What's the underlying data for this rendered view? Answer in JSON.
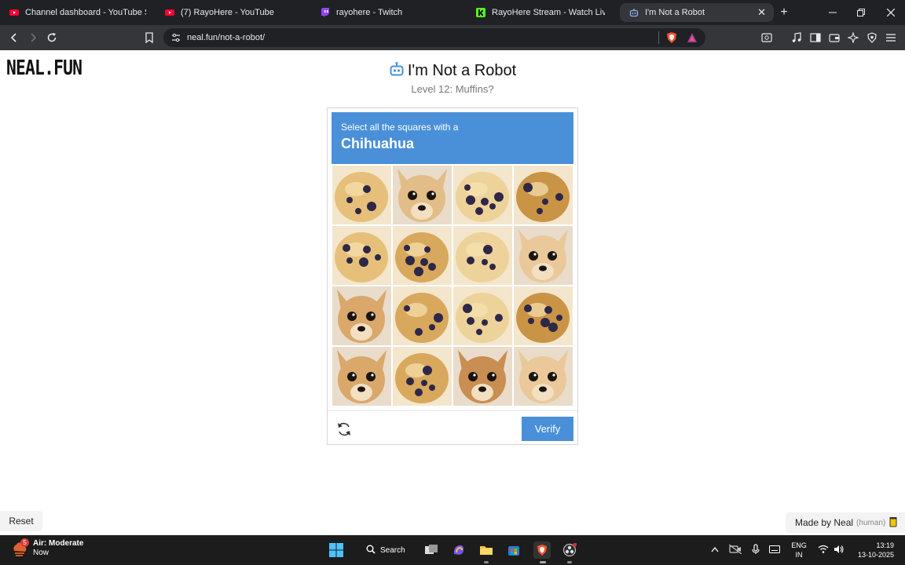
{
  "browser": {
    "tabs": [
      {
        "label": "Channel dashboard - YouTube Studio",
        "icon": "youtube-studio-icon"
      },
      {
        "label": "(7) RayoHere - YouTube",
        "icon": "youtube-icon"
      },
      {
        "label": "rayohere - Twitch",
        "icon": "twitch-icon"
      },
      {
        "label": "RayoHere Stream - Watch Live on Kick",
        "icon": "kick-icon"
      },
      {
        "label": "I'm Not a Robot",
        "icon": "robot-icon",
        "active": true
      }
    ],
    "url": "neal.fun/not-a-robot/"
  },
  "page": {
    "logo": "NEAL.FUN",
    "title": "I'm Not a Robot",
    "subtitle": "Level 12: Muffins?",
    "reset_label": "Reset",
    "made_by": "Made by Neal",
    "made_by_note": "(human)"
  },
  "captcha": {
    "instruction": "Select all the squares with a",
    "target": "Chihuahua",
    "verify_label": "Verify",
    "tiles": [
      {
        "content": "muffin"
      },
      {
        "content": "chihuahua"
      },
      {
        "content": "muffin"
      },
      {
        "content": "muffin"
      },
      {
        "content": "muffin"
      },
      {
        "content": "muffin"
      },
      {
        "content": "muffin"
      },
      {
        "content": "chihuahua"
      },
      {
        "content": "chihuahua"
      },
      {
        "content": "muffin"
      },
      {
        "content": "muffin"
      },
      {
        "content": "muffin"
      },
      {
        "content": "chihuahua"
      },
      {
        "content": "muffin"
      },
      {
        "content": "chihuahua"
      },
      {
        "content": "chihuahua"
      }
    ]
  },
  "taskbar": {
    "weather_title": "Air: Moderate",
    "weather_sub": "Now",
    "weather_badge": "5",
    "search_label": "Search",
    "lang_top": "ENG",
    "lang_bottom": "IN",
    "time": "13:19",
    "date": "13-10-2025"
  },
  "colors": {
    "captcha_blue": "#4a90d9",
    "tab_bar": "#202124",
    "taskbar": "#1c1c1c"
  }
}
